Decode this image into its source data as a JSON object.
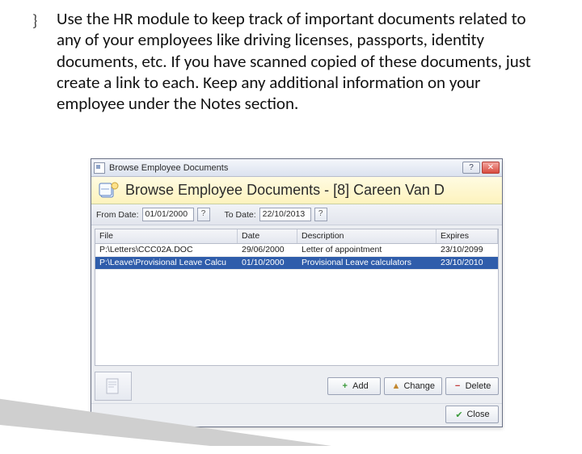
{
  "slide": {
    "bullet_glyph": "}",
    "text": "Use the HR module to keep track of important documents related to any of your employees like driving licenses, passports, identity documents, etc. If you have scanned copied of these documents, just create a link to each. Keep any additional information on your employee under the Notes section."
  },
  "window": {
    "title": "Browse Employee Documents",
    "header_text": "Browse Employee Documents - [8] Careen Van D",
    "close_glyph": "✕",
    "help_glyph": "?"
  },
  "filters": {
    "from_label": "From Date:",
    "from_value": "01/01/2000",
    "to_label": "To Date:",
    "to_value": "22/10/2013",
    "picker_glyph": "?"
  },
  "columns": {
    "file": "File",
    "date": "Date",
    "desc": "Description",
    "expires": "Expires"
  },
  "rows": [
    {
      "file": "P:\\Letters\\CCC02A.DOC",
      "date": "29/06/2000",
      "desc": "Letter of appointment",
      "expires": "23/10/2099",
      "selected": false
    },
    {
      "file": "P:\\Leave\\Provisional Leave Calcu",
      "date": "01/10/2000",
      "desc": "Provisional Leave calculators",
      "expires": "23/10/2010",
      "selected": true
    }
  ],
  "buttons": {
    "add": "Add",
    "change": "Change",
    "delete": "Delete",
    "close": "Close"
  },
  "icons": {
    "add_glyph": "+",
    "change_glyph": "▲",
    "delete_glyph": "−",
    "close_check": "✔"
  }
}
